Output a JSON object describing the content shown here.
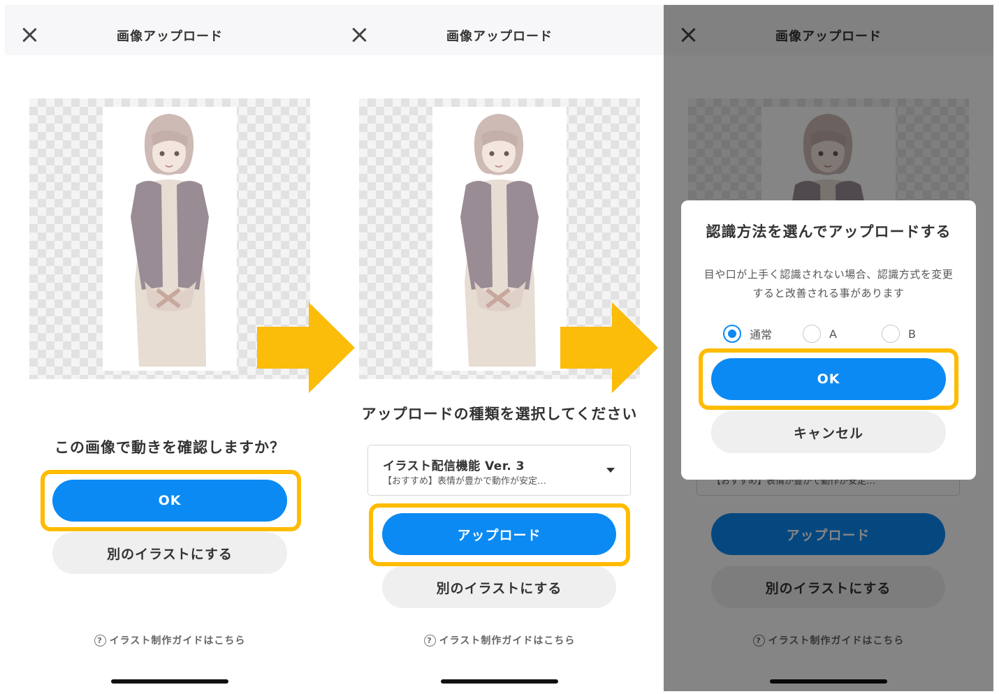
{
  "header": {
    "title": "画像アップロード"
  },
  "screen1": {
    "question": "この画像で動きを確認しますか？",
    "ok_label": "OK",
    "other_label": "別のイラストにする"
  },
  "screen2": {
    "select_label": "アップロードの種類を選択してください",
    "dropdown": {
      "title": "イラスト配信機能 Ver. 3",
      "subtitle": "【おすすめ】表情が豊かで動作が安定…"
    },
    "upload_label": "アップロード",
    "other_label": "別のイラストにする"
  },
  "screen3": {
    "modal": {
      "title": "認識方法を選んでアップロードする",
      "description": "目や口が上手く認識されない場合、認識方式を変更すると改善される事があります",
      "options": [
        "通常",
        "A",
        "B"
      ],
      "selected_option": "通常",
      "ok_label": "OK",
      "cancel_label": "キャンセル"
    },
    "upload_label": "アップロード",
    "other_label": "別のイラストにする"
  },
  "guide_link": "イラスト制作ガイドはこちら",
  "colors": {
    "primary": "#0b8af3",
    "highlight": "#ffbb00",
    "overlay": "rgba(0,0,0,0.48)"
  }
}
